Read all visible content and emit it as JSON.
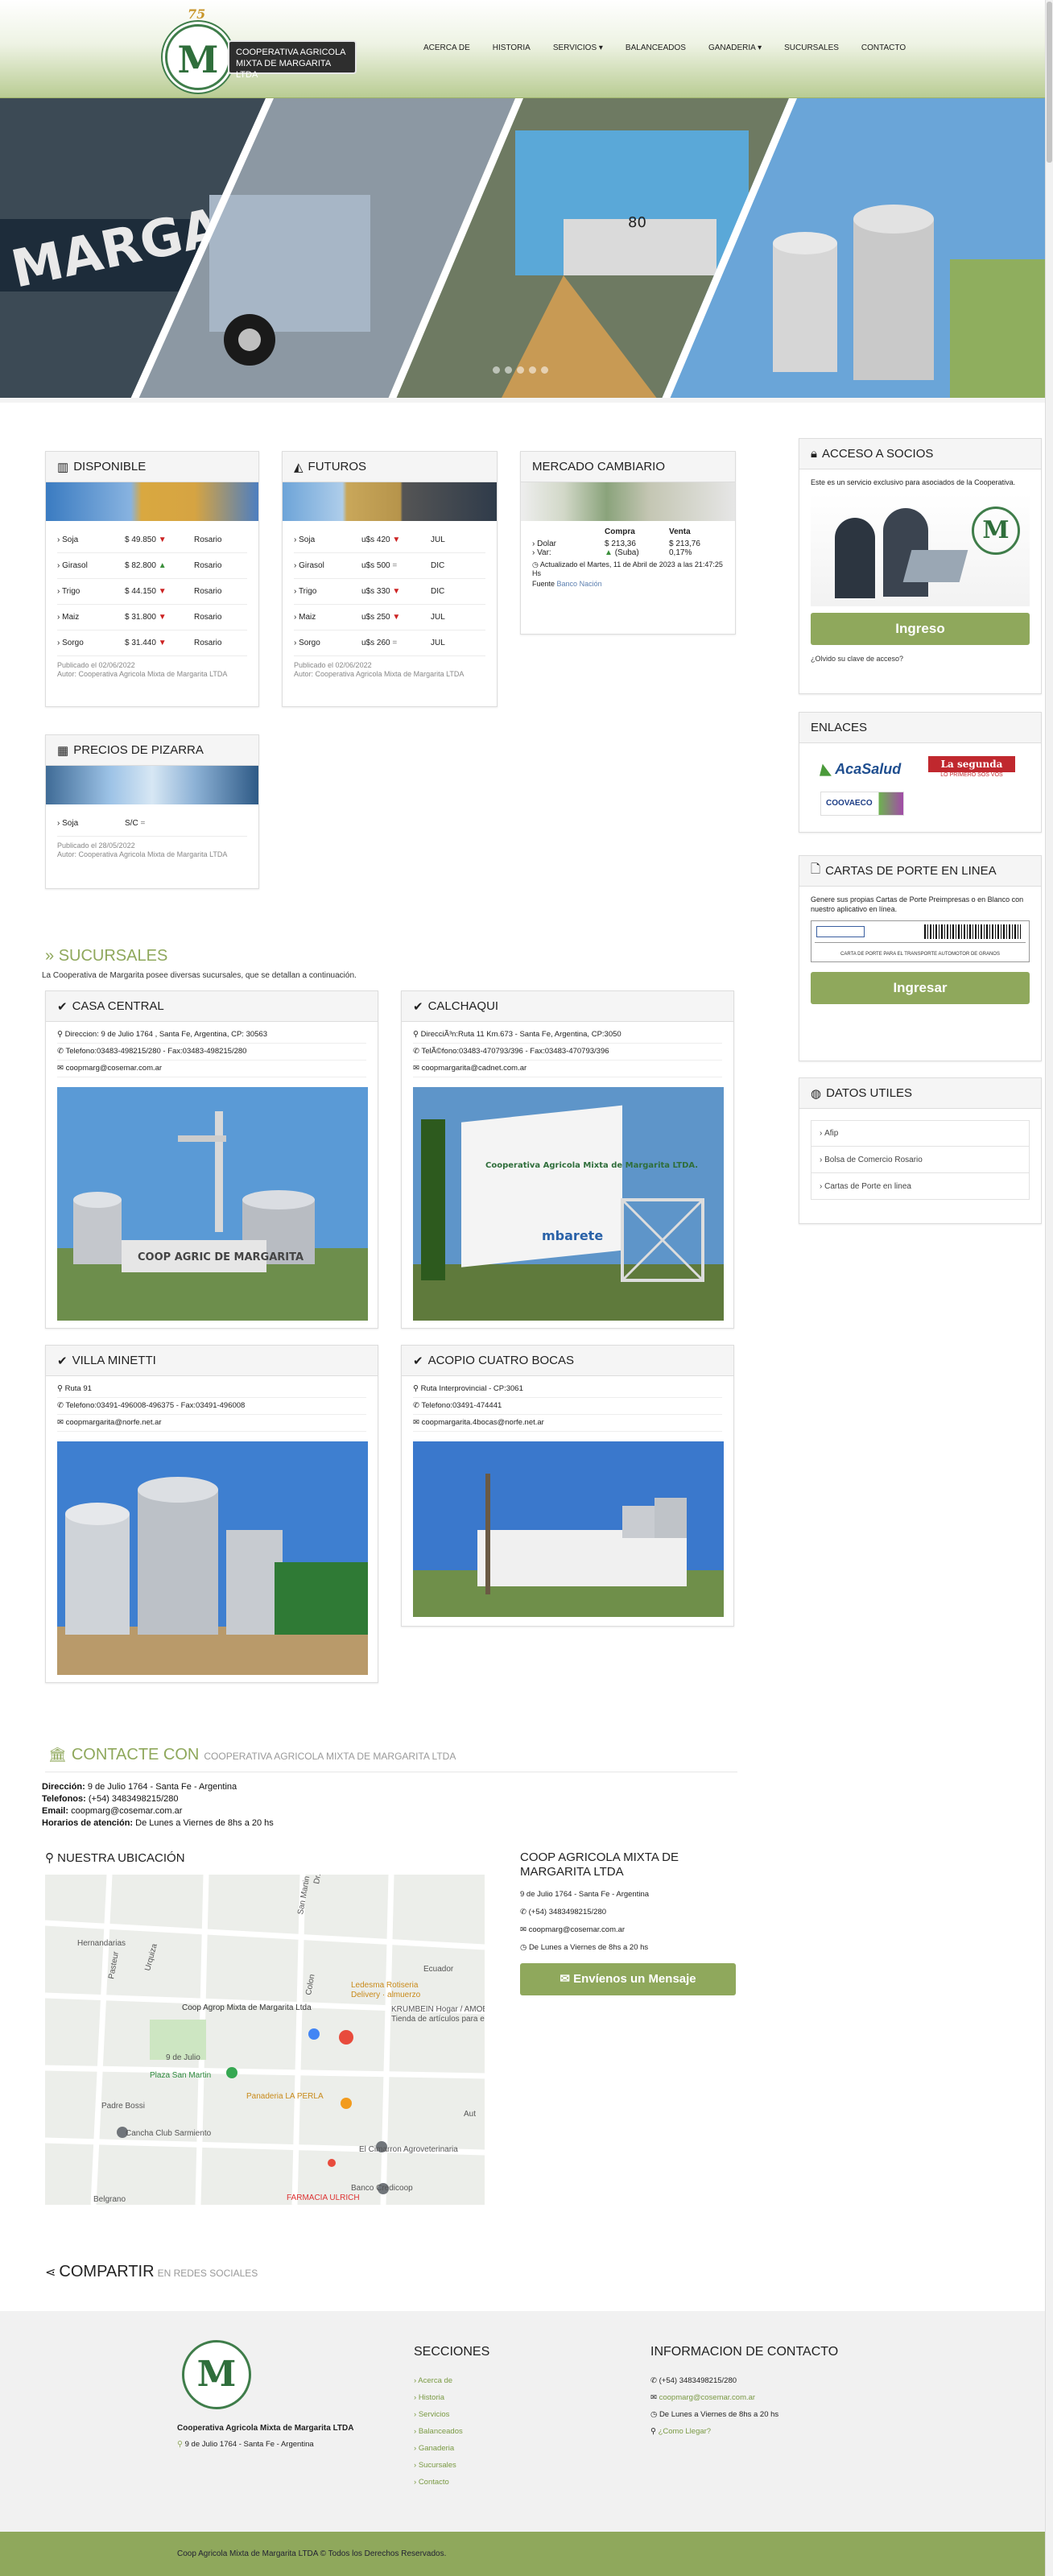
{
  "header": {
    "logo_anniversary": "75",
    "logo_line1": "COOPERATIVA AGRICOLA",
    "logo_line2": "MIXTA DE MARGARITA LTDA",
    "nav": [
      "ACERCA DE",
      "HISTORIA",
      "SERVICIOS ▾",
      "BALANCEADOS",
      "GANADERIA ▾",
      "SUCURSALES",
      "CONTACTO"
    ]
  },
  "slider": {
    "sign_text": "MARGARITA",
    "sign_prefix": "C",
    "truck_number": "80"
  },
  "disponible": {
    "title": "DISPONIBLE",
    "rows": [
      {
        "name": "Soja",
        "price": "$ 49.850",
        "trend": "▼",
        "trend_class": "dn",
        "place": "Rosario"
      },
      {
        "name": "Girasol",
        "price": "$ 82.800",
        "trend": "▲",
        "trend_class": "up",
        "place": "Rosario"
      },
      {
        "name": "Trigo",
        "price": "$ 44.150",
        "trend": "▼",
        "trend_class": "dn",
        "place": "Rosario"
      },
      {
        "name": "Maiz",
        "price": "$ 31.800",
        "trend": "▼",
        "trend_class": "dn",
        "place": "Rosario"
      },
      {
        "name": "Sorgo",
        "price": "$ 31.440",
        "trend": "▼",
        "trend_class": "dn",
        "place": "Rosario"
      }
    ],
    "published": "Publicado el 02/06/2022",
    "author": "Autor: Cooperativa Agricola Mixta de Margarita LTDA"
  },
  "futuros": {
    "title": "FUTUROS",
    "rows": [
      {
        "name": "Soja",
        "price": "u$s 420",
        "trend": "▼",
        "trend_class": "dn",
        "place": "JUL"
      },
      {
        "name": "Girasol",
        "price": "u$s 500",
        "trend": "=",
        "trend_class": "eq",
        "place": "DIC"
      },
      {
        "name": "Trigo",
        "price": "u$s 330",
        "trend": "▼",
        "trend_class": "dn",
        "place": "DIC"
      },
      {
        "name": "Maiz",
        "price": "u$s 250",
        "trend": "▼",
        "trend_class": "dn",
        "place": "JUL"
      },
      {
        "name": "Sorgo",
        "price": "u$s 260",
        "trend": "=",
        "trend_class": "eq",
        "place": "JUL"
      }
    ],
    "published": "Publicado el 02/06/2022",
    "author": "Autor: Cooperativa Agricola Mixta de Margarita LTDA"
  },
  "cambio": {
    "title": "MERCADO CAMBIARIO",
    "col_buy": "Compra",
    "col_sell": "Venta",
    "dolar_label": "Dolar",
    "dolar_buy": "$ 213,36",
    "dolar_sell": "$ 213,76",
    "var_label": "Var:",
    "var_buy": "(Suba)",
    "var_sell": "0,17%",
    "updated": "Actualizado el Martes, 11 de Abril de 2023 a las 21:47:25 Hs",
    "source_label": "Fuente",
    "source": "Banco Nación"
  },
  "pizarra": {
    "title": "PRECIOS DE PIZARRA",
    "row_name": "Soja",
    "row_price": "S/C",
    "row_trend": "=",
    "published": "Publicado el 28/05/2022",
    "author": "Autor: Cooperativa Agricola Mixta de Margarita LTDA"
  },
  "socios": {
    "title": "ACCESO A SOCIOS",
    "text": "Este es un servicio exclusivo para asociados de la Cooperativa.",
    "button": "Ingreso",
    "forgot": "¿Olvido su clave de acceso?"
  },
  "enlaces": {
    "title": "ENLACES",
    "acasalud": "AcaSalud",
    "lasegunda": "La segunda",
    "lasegunda_sub": "LO PRIMERO SOS VOS",
    "coovaeco": "COOVAECO"
  },
  "cartas": {
    "title": "CARTAS DE PORTE EN LINEA",
    "text": "Genere sus propias Cartas de Porte Preimpresas o en Blanco con nuestro aplicativo en línea.",
    "doc_caption": "CARTA DE PORTE PARA EL TRANSPORTE AUTOMOTOR DE GRANOS",
    "button": "Ingresar"
  },
  "datos": {
    "title": "DATOS UTILES",
    "links": [
      "Afip",
      "Bolsa de Comercio Rosario",
      "Cartas de Porte en linea"
    ]
  },
  "sucursales": {
    "title": "SUCURSALES",
    "intro": "La Cooperativa de Margarita posee diversas sucursales, que se detallan a continuación.",
    "items": [
      {
        "name": "CASA CENTRAL",
        "address": "Direccion: 9 de Julio 1764 , Santa Fe, Argentina, CP: 30563",
        "phone": "Telefono:03483-498215/280 - Fax:03483-498215/280",
        "email": "coopmarg@cosemar.com.ar",
        "sign": "COOP AGRIC DE MARGARITA"
      },
      {
        "name": "CALCHAQUI",
        "address": "DirecciÃ³n:Ruta 11 Km.673 - Santa Fe, Argentina, CP:3050",
        "phone": "TelÃ©fono:03483-470793/396 - Fax:03483-470793/396",
        "email": "coopmargarita@cadnet.com.ar",
        "sign": "Cooperativa Agricola Mixta de Margarita LTDA.",
        "sign2": "mbarete"
      },
      {
        "name": "VILLA MINETTI",
        "address": "Ruta 91",
        "phone": "Telefono:03491-496008-496375 - Fax:03491-496008",
        "email": "coopmargarita@norfe.net.ar"
      },
      {
        "name": "ACOPIO CUATRO BOCAS",
        "address": "Ruta Interprovincial - CP:3061",
        "phone": "Telefono:03491-474441",
        "email": "coopmargarita.4bocas@norfe.net.ar"
      }
    ]
  },
  "contacto": {
    "title": "CONTACTE CON",
    "subtitle": "COOPERATIVA AGRICOLA MIXTA DE MARGARITA LTDA",
    "dir_label": "Dirección:",
    "dir": "9 de Julio 1764 - Santa Fe - Argentina",
    "tel_label": "Telefonos:",
    "tel": "(+54) 3483498215/280",
    "email_label": "Email:",
    "email": "coopmarg@cosemar.com.ar",
    "hor_label": "Horarios de atención:",
    "hor": "De Lunes a Viernes de 8hs a 20 hs"
  },
  "ubicacion": {
    "title": "NUESTRA UBICACIÓN",
    "map_labels": [
      "Dr. Rene Favaloro",
      "Hernandarias",
      "San Martin",
      "Colon",
      "Ledesma Rotiseria",
      "Delivery · almuerzo",
      "Coop Agrop Mixta de Margarita Ltda",
      "KRUMBEIN Hogar / AMOBLARK",
      "Tienda de artículos para el hogar",
      "9 de Julio",
      "Plaza San Martin",
      "Panaderia LA PERLA",
      "Padre Bossi",
      "Cancha Club Sarmiento",
      "El Cimarron Agroveterinaria",
      "Banco Credicoop",
      "FARMACIA ULRICH",
      "Belgrano",
      "Urquiza",
      "Pasteur",
      "Ecuador",
      "Aut"
    ]
  },
  "coop_info": {
    "title": "COOP AGRICOLA MIXTA DE MARGARITA LTDA",
    "addr": "9 de Julio 1764 - Santa Fe - Argentina",
    "tel": "(+54) 3483498215/280",
    "email": "coopmarg@cosemar.com.ar",
    "hours": "De Lunes a Viernes de 8hs a 20 hs",
    "button": "Envíenos un Mensaje"
  },
  "compartir": {
    "title": "COMPARTIR",
    "subtitle": "EN REDES SOCIALES"
  },
  "footer": {
    "org": "Cooperativa Agricola Mixta de Margarita LTDA",
    "addr": "9 de Julio 1764 - Santa Fe - Argentina",
    "sections_title": "SECCIONES",
    "sections": [
      "Acerca de",
      "Historia",
      "Servicios",
      "Balanceados",
      "Ganaderia",
      "Sucursales",
      "Contacto"
    ],
    "contact_title": "INFORMACION DE CONTACTO",
    "phone": "(+54) 3483498215/280",
    "email": "coopmarg@cosemar.com.ar",
    "hours": "De Lunes a Viernes de 8hs a 20 hs",
    "howto": "¿Como Llegar?",
    "copyright": "Coop Agricola Mixta de Margarita LTDA © Todos los Derechos Reservados."
  },
  "colors": {
    "brand_green": "#8fa85c",
    "dark_green": "#3f7d4a",
    "header_bottom": "#b9cc93",
    "footer_bg": "#f1f1f1"
  }
}
